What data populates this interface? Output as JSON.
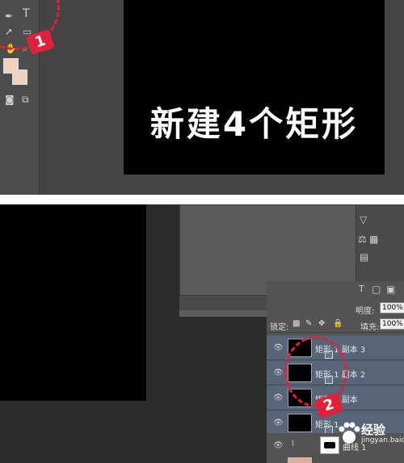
{
  "top": {
    "tools": {
      "type_tool": "T"
    },
    "annotation_step": "1",
    "overlay_text": "新建4个矩形"
  },
  "bottom": {
    "opacity_label": "明度:",
    "opacity_value": "100%",
    "lock_label": "锁定:",
    "fill_label": "填充:",
    "fill_value": "100%",
    "layers": [
      {
        "name": "矩形 1 副本 3"
      },
      {
        "name": "矩形 1 副本 2"
      },
      {
        "name": "矩形 1 副本"
      },
      {
        "name": "矩形 1"
      }
    ],
    "adjustment_layer_label": "曲线 1",
    "annotation_step": "2",
    "type_filter_icon": "T"
  },
  "watermark": {
    "text": "经验",
    "url": "jingyan.baidu.com"
  },
  "colors": {
    "foreground": "#f1d2bf",
    "annotation": "#e0213a",
    "selected_layer": "#586478"
  },
  "icons": [
    "pen-icon",
    "type-icon",
    "path-select-icon",
    "rectangle-icon",
    "hand-icon",
    "zoom-icon",
    "eye-icon",
    "trash-icon",
    "lock-icon",
    "brush-icon",
    "move-icon",
    "curves-icon"
  ]
}
